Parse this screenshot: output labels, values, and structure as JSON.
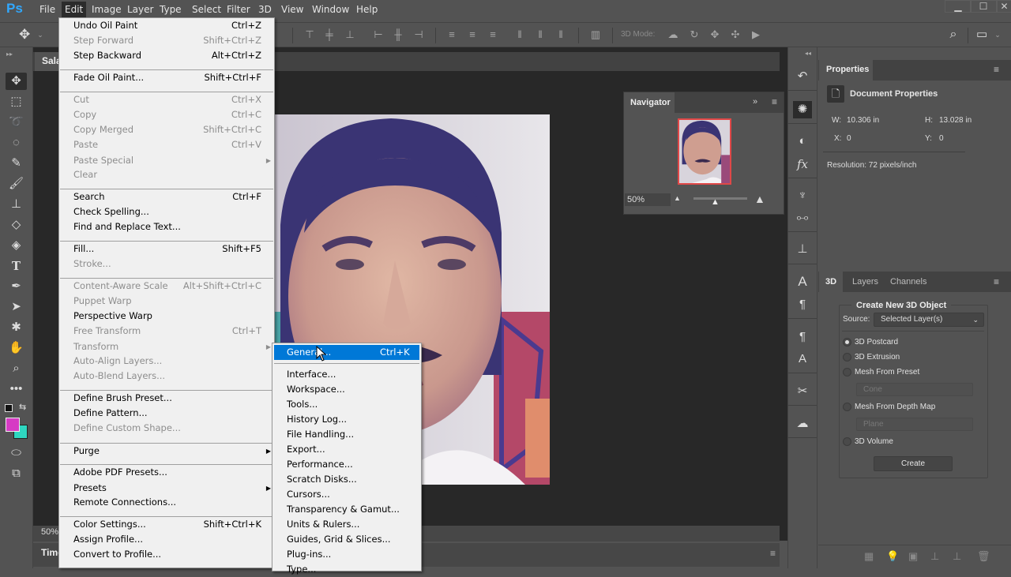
{
  "app": {
    "logo": "Ps"
  },
  "menubar": {
    "items": [
      "File",
      "Edit",
      "Image",
      "Layer",
      "Type",
      "Select",
      "Filter",
      "3D",
      "View",
      "Window",
      "Help"
    ],
    "active": "Edit"
  },
  "window_controls": {
    "minimize": "▁",
    "maximize": "☐",
    "close": "✕"
  },
  "options_bar": {
    "tool_icon": "move-icon",
    "mode_3d_label": "3D Mode:",
    "search_icon": "search-icon",
    "workspace_icon": "workspace-icon"
  },
  "document": {
    "tab_label": "Sala",
    "zoom_status": "50%",
    "timeline_label": "Time"
  },
  "tools": [
    "move-tool",
    "marquee-tool",
    "lasso-tool",
    "quick-selection-tool",
    "eyedropper-tool",
    "brush-tool",
    "clone-stamp-tool",
    "eraser-tool",
    "paint-bucket-tool",
    "type-tool",
    "pen-tool",
    "path-selection-tool",
    "custom-shape-tool",
    "hand-tool",
    "zoom-tool",
    "more-tools"
  ],
  "colors": {
    "foreground": "#d63bc4",
    "background": "#2fd6c0",
    "highlight": "#0078d7",
    "nav_frame": "#e04848"
  },
  "navigator": {
    "title": "Navigator",
    "zoom": "50%"
  },
  "properties": {
    "title": "Properties",
    "section": "Document Properties",
    "w_label": "W:",
    "w_value": "10.306 in",
    "h_label": "H:",
    "h_value": "13.028 in",
    "x_label": "X:",
    "x_value": "0",
    "y_label": "Y:",
    "y_value": "0",
    "resolution": "Resolution: 72 pixels/inch"
  },
  "panel3d": {
    "tabs": [
      "3D",
      "Layers",
      "Channels"
    ],
    "active_tab": "3D",
    "group_title": "Create New 3D Object",
    "source_label": "Source:",
    "source_value": "Selected Layer(s)",
    "options": [
      {
        "label": "3D Postcard",
        "selected": true
      },
      {
        "label": "3D Extrusion",
        "selected": false
      },
      {
        "label": "Mesh From Preset",
        "selected": false
      },
      {
        "label": "Mesh From Depth Map",
        "selected": false
      },
      {
        "label": "3D Volume",
        "selected": false
      }
    ],
    "preset_value": "Cone",
    "depth_map_value": "Plane",
    "create_label": "Create"
  },
  "edit_menu": {
    "items": [
      {
        "label": "Undo Oil Paint",
        "shortcut": "Ctrl+Z",
        "enabled": true
      },
      {
        "label": "Step Forward",
        "shortcut": "Shift+Ctrl+Z",
        "enabled": false
      },
      {
        "label": "Step Backward",
        "shortcut": "Alt+Ctrl+Z",
        "enabled": true
      },
      {
        "label": "Fade Oil Paint...",
        "shortcut": "Shift+Ctrl+F",
        "enabled": true
      },
      {
        "label": "Cut",
        "shortcut": "Ctrl+X",
        "enabled": false
      },
      {
        "label": "Copy",
        "shortcut": "Ctrl+C",
        "enabled": false
      },
      {
        "label": "Copy Merged",
        "shortcut": "Shift+Ctrl+C",
        "enabled": false
      },
      {
        "label": "Paste",
        "shortcut": "Ctrl+V",
        "enabled": false
      },
      {
        "label": "Paste Special",
        "shortcut": "",
        "enabled": false,
        "submenu": true
      },
      {
        "label": "Clear",
        "shortcut": "",
        "enabled": false
      },
      {
        "label": "Search",
        "shortcut": "Ctrl+F",
        "enabled": true
      },
      {
        "label": "Check Spelling...",
        "shortcut": "",
        "enabled": true
      },
      {
        "label": "Find and Replace Text...",
        "shortcut": "",
        "enabled": true
      },
      {
        "label": "Fill...",
        "shortcut": "Shift+F5",
        "enabled": true
      },
      {
        "label": "Stroke...",
        "shortcut": "",
        "enabled": false
      },
      {
        "label": "Content-Aware Scale",
        "shortcut": "Alt+Shift+Ctrl+C",
        "enabled": false
      },
      {
        "label": "Puppet Warp",
        "shortcut": "",
        "enabled": false
      },
      {
        "label": "Perspective Warp",
        "shortcut": "",
        "enabled": true
      },
      {
        "label": "Free Transform",
        "shortcut": "Ctrl+T",
        "enabled": false
      },
      {
        "label": "Transform",
        "shortcut": "",
        "enabled": false,
        "submenu": true
      },
      {
        "label": "Auto-Align Layers...",
        "shortcut": "",
        "enabled": false
      },
      {
        "label": "Auto-Blend Layers...",
        "shortcut": "",
        "enabled": false
      },
      {
        "label": "Define Brush Preset...",
        "shortcut": "",
        "enabled": true
      },
      {
        "label": "Define Pattern...",
        "shortcut": "",
        "enabled": true
      },
      {
        "label": "Define Custom Shape...",
        "shortcut": "",
        "enabled": false
      },
      {
        "label": "Purge",
        "shortcut": "",
        "enabled": true,
        "submenu": true
      },
      {
        "label": "Adobe PDF Presets...",
        "shortcut": "",
        "enabled": true
      },
      {
        "label": "Presets",
        "shortcut": "",
        "enabled": true,
        "submenu": true
      },
      {
        "label": "Remote Connections...",
        "shortcut": "",
        "enabled": true
      },
      {
        "label": "Color Settings...",
        "shortcut": "Shift+Ctrl+K",
        "enabled": true
      },
      {
        "label": "Assign Profile...",
        "shortcut": "",
        "enabled": true
      },
      {
        "label": "Convert to Profile...",
        "shortcut": "",
        "enabled": true
      }
    ]
  },
  "preferences_submenu": {
    "items": [
      {
        "label": "General...",
        "shortcut": "Ctrl+K",
        "highlighted": true
      },
      {
        "label": "Interface..."
      },
      {
        "label": "Workspace..."
      },
      {
        "label": "Tools..."
      },
      {
        "label": "History Log..."
      },
      {
        "label": "File Handling..."
      },
      {
        "label": "Export..."
      },
      {
        "label": "Performance..."
      },
      {
        "label": "Scratch Disks..."
      },
      {
        "label": "Cursors..."
      },
      {
        "label": "Transparency & Gamut..."
      },
      {
        "label": "Units & Rulers..."
      },
      {
        "label": "Guides, Grid & Slices..."
      },
      {
        "label": "Plug-ins..."
      },
      {
        "label": "Type..."
      }
    ]
  }
}
